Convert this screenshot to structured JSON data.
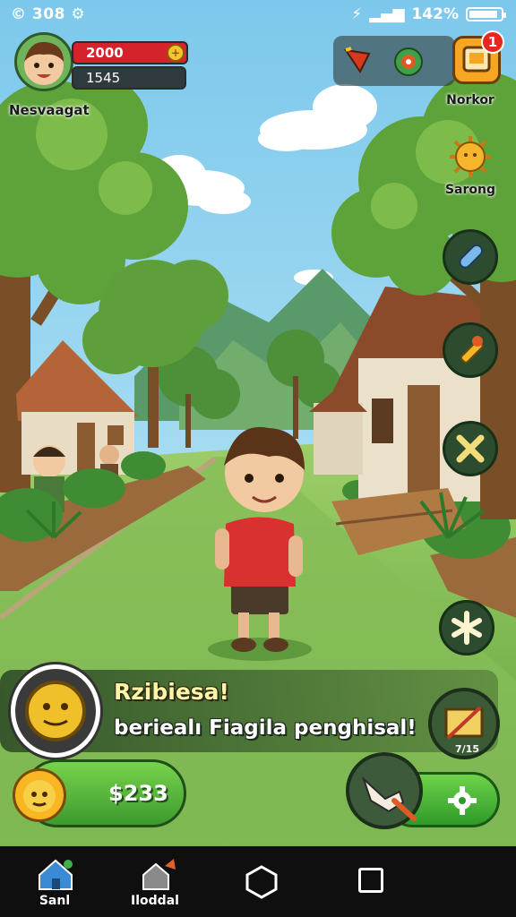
{
  "status_bar": {
    "left_text": "© 308 ⚙",
    "right_text": "142%",
    "battery_level": 0.9
  },
  "player": {
    "health_value": "2000",
    "sub_value": "1545",
    "name": "Nesvaagat"
  },
  "top_right": {
    "shop_label": "Norkor",
    "shop_badge": "1",
    "sun_label": "Sarong"
  },
  "dialog": {
    "title": "Rzibiesa!",
    "text": "beriealı Fiagila penghisal!"
  },
  "money": {
    "amount": "$233"
  },
  "craft": {
    "count_label": "7/15"
  },
  "navbar": {
    "tab1_label": "Sanl",
    "tab2_label": "Iloddal"
  },
  "colors": {
    "sky": "#8fd0ee",
    "grass": "#6fb24a",
    "accent_green": "#3c9a2e",
    "health_red": "#d4232a"
  }
}
